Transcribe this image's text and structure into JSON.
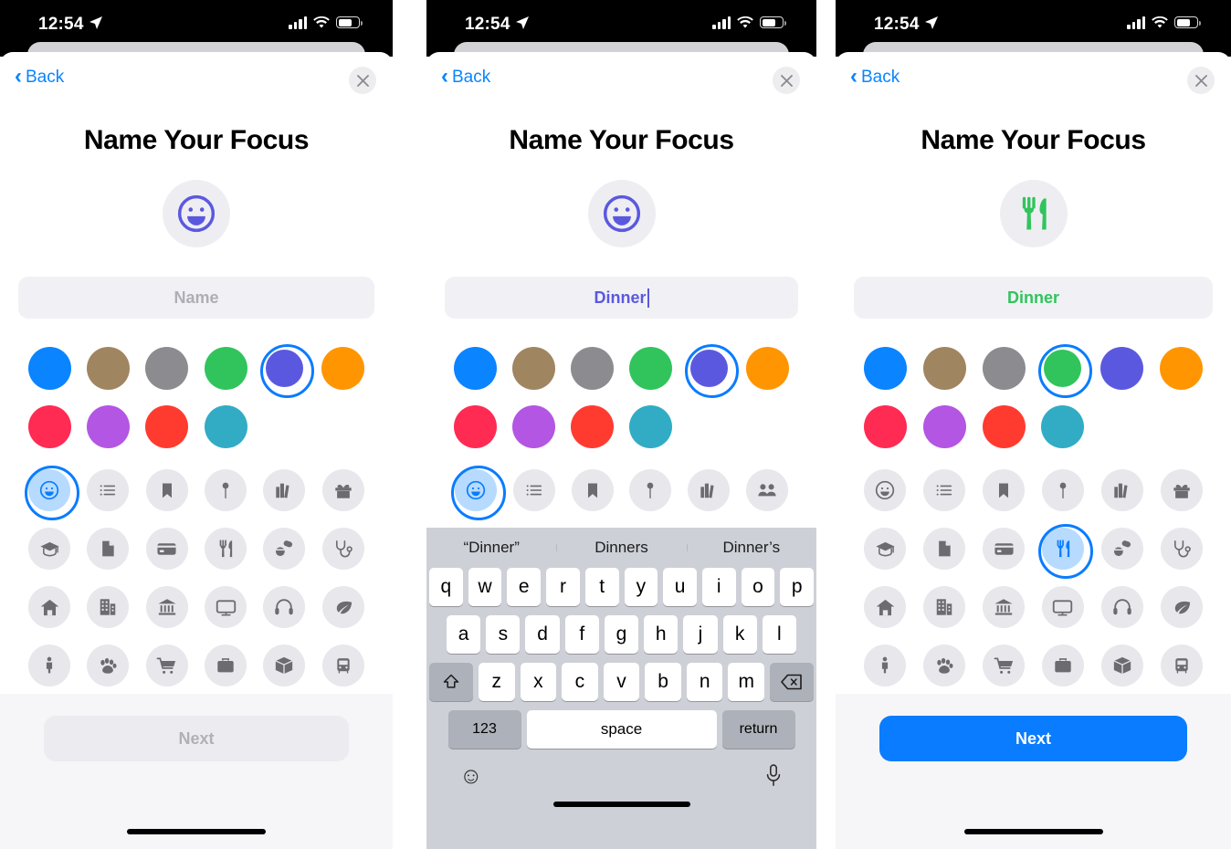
{
  "statusbar": {
    "time": "12:54",
    "location_icon": "location-arrow-icon",
    "cellular_icon": "cellular-bars-icon",
    "wifi_icon": "wifi-icon",
    "battery_icon": "battery-icon"
  },
  "nav": {
    "back_label": "Back",
    "close_icon": "close-icon"
  },
  "page_title": "Name Your Focus",
  "palette": {
    "accent_blue": "#0a7cff",
    "selection_ring": "#0a7cff",
    "chip_bg": "#e7e7ec",
    "field_bg": "#f1f1f5",
    "sheet_bg": "#ffffff",
    "bottom_bar_bg": "#f6f6f8"
  },
  "colors": [
    {
      "name": "blue",
      "hex": "#0a84ff"
    },
    {
      "name": "brown",
      "hex": "#a08561"
    },
    {
      "name": "gray",
      "hex": "#8b8b90"
    },
    {
      "name": "green",
      "hex": "#31c45c"
    },
    {
      "name": "indigo",
      "hex": "#5b58e0"
    },
    {
      "name": "orange",
      "hex": "#ff9500"
    },
    {
      "name": "pink",
      "hex": "#ff2b53"
    },
    {
      "name": "purple",
      "hex": "#b356e3"
    },
    {
      "name": "red",
      "hex": "#ff3b2f"
    },
    {
      "name": "teal",
      "hex": "#31acc4"
    }
  ],
  "icons": [
    "smiley-icon",
    "list-icon",
    "bookmark-icon",
    "pin-icon",
    "books-icon",
    "gift-icon",
    "graduation-cap-icon",
    "document-icon",
    "credit-card-icon",
    "fork-knife-icon",
    "pills-icon",
    "stethoscope-icon",
    "home-icon",
    "building-icon",
    "bank-icon",
    "monitor-icon",
    "headphones-icon",
    "leaf-icon",
    "person-icon",
    "paw-icon",
    "shopping-cart-icon",
    "briefcase-icon",
    "box-icon",
    "bus-icon"
  ],
  "panels": [
    {
      "id": "panel-empty-name",
      "avatar_icon": "smiley-icon",
      "avatar_icon_color": "#5b58e0",
      "name_value": "",
      "name_placeholder": "Name",
      "name_text_color": "#aeaeb4",
      "selected_color_index": 4,
      "selected_icon_index": 0,
      "next_label": "Next",
      "next_enabled": false,
      "keyboard_visible": false
    },
    {
      "id": "panel-typing",
      "avatar_icon": "smiley-icon",
      "avatar_icon_color": "#5b58e0",
      "name_value": "Dinner",
      "name_placeholder": "Name",
      "name_text_color": "#5b58e0",
      "selected_color_index": 4,
      "selected_icon_index": 0,
      "next_label": "Next",
      "next_enabled": false,
      "keyboard_visible": true,
      "keyboard": {
        "predictions": [
          "“Dinner”",
          "Dinners",
          "Dinner’s"
        ],
        "row1": [
          "q",
          "w",
          "e",
          "r",
          "t",
          "y",
          "u",
          "i",
          "o",
          "p"
        ],
        "row2": [
          "a",
          "s",
          "d",
          "f",
          "g",
          "h",
          "j",
          "k",
          "l"
        ],
        "row3": [
          "z",
          "x",
          "c",
          "v",
          "b",
          "n",
          "m"
        ],
        "shift_icon": "shift-icon",
        "backspace_icon": "backspace-icon",
        "numbers_label": "123",
        "space_label": "space",
        "return_label": "return",
        "emoji_icon": "emoji-keyboard-icon",
        "mic_icon": "microphone-icon"
      }
    },
    {
      "id": "panel-selected-green",
      "avatar_icon": "fork-knife-icon",
      "avatar_icon_color": "#31c45c",
      "name_value": "Dinner",
      "name_placeholder": "Name",
      "name_text_color": "#31c45c",
      "selected_color_index": 3,
      "selected_icon_index": 9,
      "next_label": "Next",
      "next_enabled": true,
      "keyboard_visible": false
    }
  ]
}
